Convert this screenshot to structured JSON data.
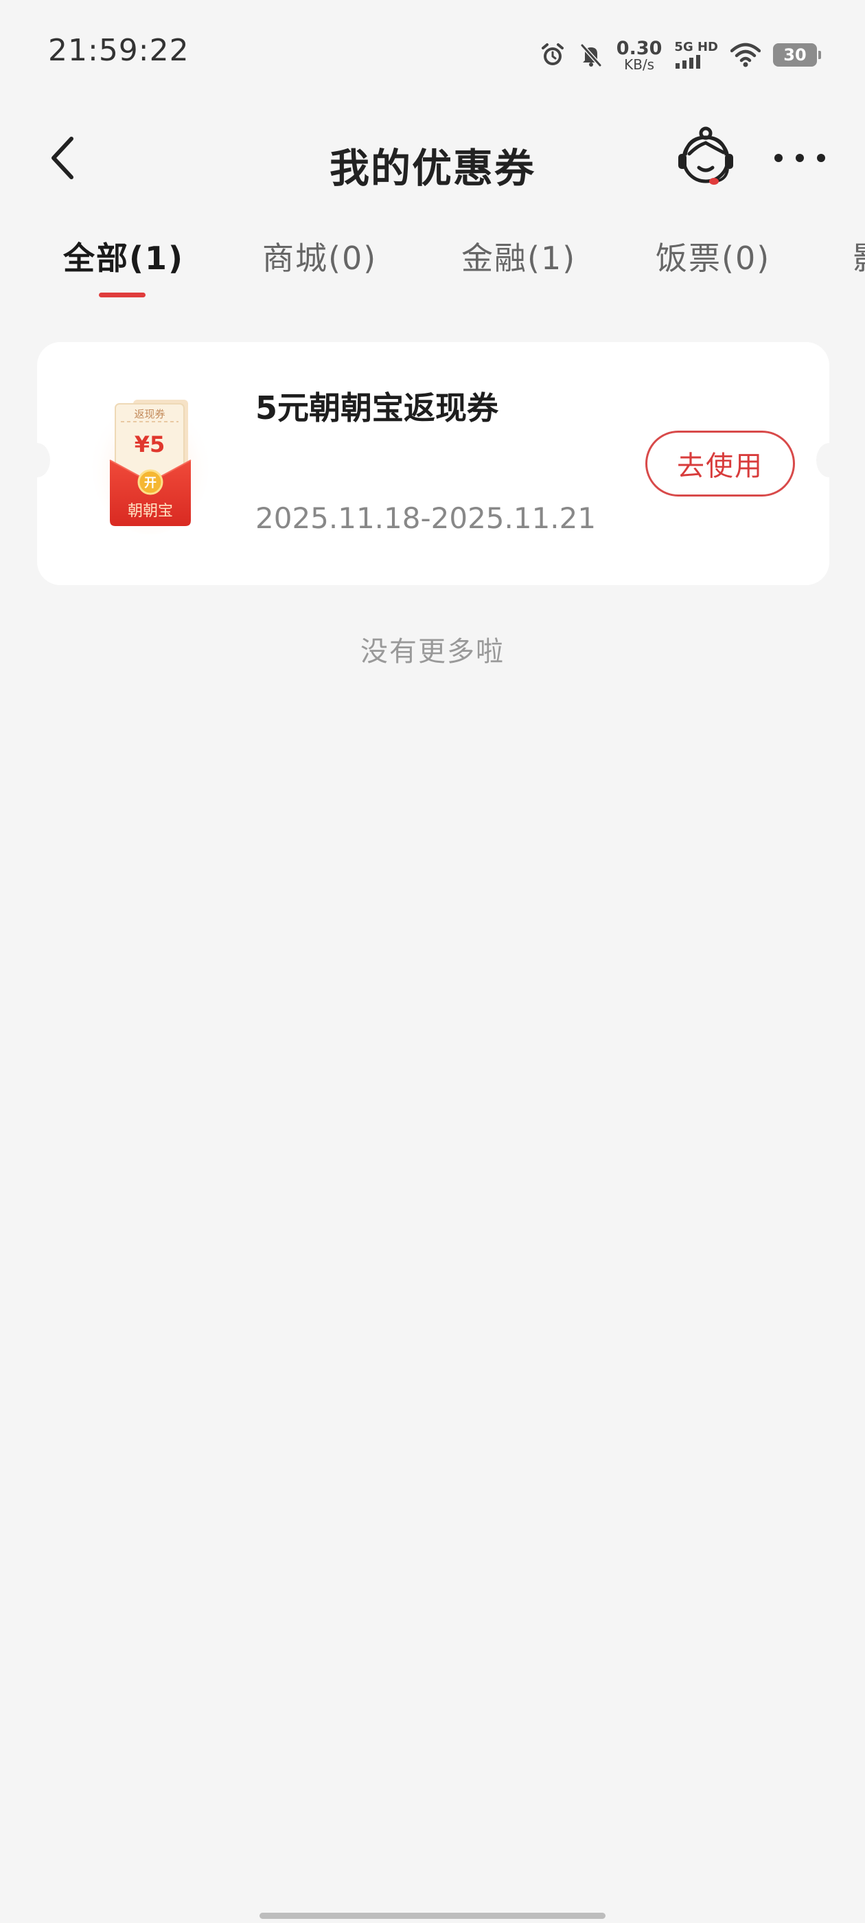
{
  "status_bar": {
    "time": "21:59:22",
    "speed_value": "0.30",
    "speed_unit": "KB/s",
    "network_label": "5G HD",
    "battery": "30",
    "icons": [
      "alarm-icon",
      "mute-bell-icon",
      "signal-icon",
      "wifi-icon",
      "battery-icon"
    ]
  },
  "header": {
    "title": "我的优惠券",
    "icons": [
      "back-arrow-icon",
      "customer-service-icon",
      "more-dots-icon"
    ]
  },
  "tabs": [
    {
      "label": "全部(1)",
      "active": true
    },
    {
      "label": "商城(0)",
      "active": false
    },
    {
      "label": "金融(1)",
      "active": false
    },
    {
      "label": "饭票(0)",
      "active": false
    },
    {
      "label": "影",
      "active": false
    }
  ],
  "coupon": {
    "title": "5元朝朝宝返现券",
    "date_range": "2025.11.18-2025.11.21",
    "action_label": "去使用",
    "image": {
      "top_label": "返现券",
      "amount": "¥5",
      "badge": "开",
      "envelope_label": "朝朝宝"
    }
  },
  "footer_text": "没有更多啦",
  "colors": {
    "accent": "#e03c3c",
    "background": "#f5f5f5",
    "card": "#ffffff"
  }
}
